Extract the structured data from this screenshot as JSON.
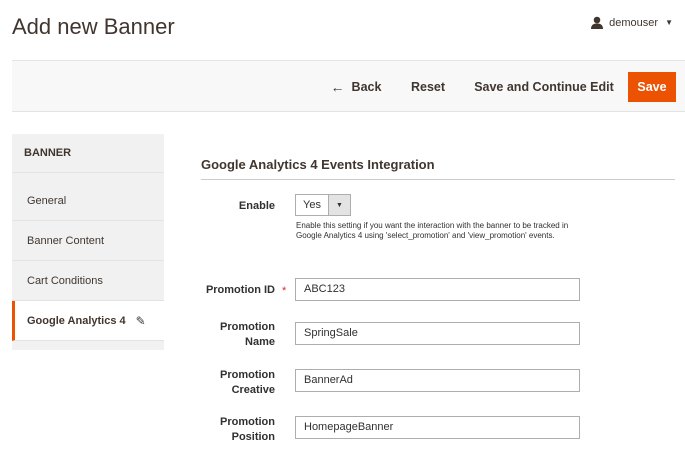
{
  "page": {
    "title": "Add new Banner",
    "user": {
      "name": "demouser",
      "icon": "user-icon"
    }
  },
  "actions": {
    "back_label": "Back",
    "reset_label": "Reset",
    "save_continue_label": "Save and Continue Edit",
    "save_label": "Save",
    "accent_color": "#eb5202"
  },
  "sidebar": {
    "heading": "BANNER",
    "items": [
      {
        "label": "General"
      },
      {
        "label": "Banner Content"
      },
      {
        "label": "Cart Conditions"
      },
      {
        "label": "Google Analytics 4",
        "active": true,
        "icon": "pencil-icon"
      }
    ]
  },
  "section": {
    "title": "Google Analytics 4 Events Integration",
    "enable": {
      "label": "Enable",
      "value": "Yes",
      "note": "Enable this setting if you want the interaction with the banner to be tracked in Google Analytics 4 using 'select_promotion' and 'view_promotion' events."
    },
    "promotion_id": {
      "label": "Promotion ID",
      "value": "ABC123",
      "required": true
    },
    "promotion_name": {
      "label_1": "Promotion",
      "label_2": "Name",
      "value": "SpringSale"
    },
    "promotion_creative": {
      "label_1": "Promotion",
      "label_2": "Creative",
      "value": "BannerAd"
    },
    "promotion_position": {
      "label_1": "Promotion",
      "label_2": "Position",
      "value": "HomepageBanner"
    }
  }
}
